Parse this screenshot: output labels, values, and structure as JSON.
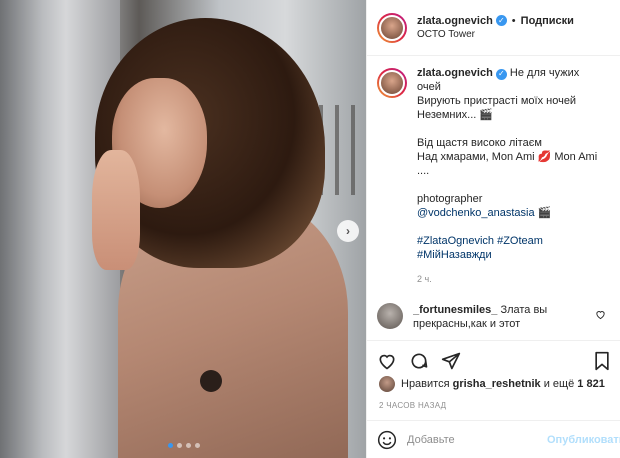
{
  "post": {
    "username": "zlata.ognevich",
    "dot": "•",
    "follow_label": "Подписки",
    "location": "OCTO Tower",
    "verified_mark": "✓"
  },
  "caption": {
    "lines": [
      "Не для чужих",
      "очей",
      "Вирують пристрасті моїх ночей",
      "Неземних... 🎬"
    ],
    "lines2": [
      "Від щастя високо літаєм",
      "Над хмарами, Mon Ami 💋 Mon Ami",
      "...."
    ],
    "photographer_label": "photographer",
    "photographer_tag": "@vodchenko_anastasia",
    "photographer_emoji": "🎬",
    "hashtags_line1": "#ZlataOgnevich #ZOteam",
    "hashtags_line2": "#МійНазавжди",
    "time": "2 ч."
  },
  "comment": {
    "username": "_fortunesmiles_",
    "text": "Злата вы прекрасны,как и этот"
  },
  "likes": {
    "prefix": "Нравится",
    "user": "grisha_reshetnik",
    "suffix": "и ещё",
    "count": "1 821"
  },
  "posted_ago": "2 ЧАСОВ НАЗАД",
  "add_comment": {
    "placeholder": "Добавьте",
    "publish_label": "Опубликовать"
  },
  "carousel": {
    "next_label": "›",
    "current": 1,
    "total": 4
  },
  "colors": {
    "accent": "#3897f0",
    "hashtag": "#003569",
    "muted": "#8e8e8e",
    "publish_disabled": "#b2dffc"
  },
  "icons": [
    "heart-icon",
    "comment-icon",
    "share-icon",
    "bookmark-icon",
    "emoji-icon",
    "verified-icon",
    "chevron-right-icon"
  ]
}
